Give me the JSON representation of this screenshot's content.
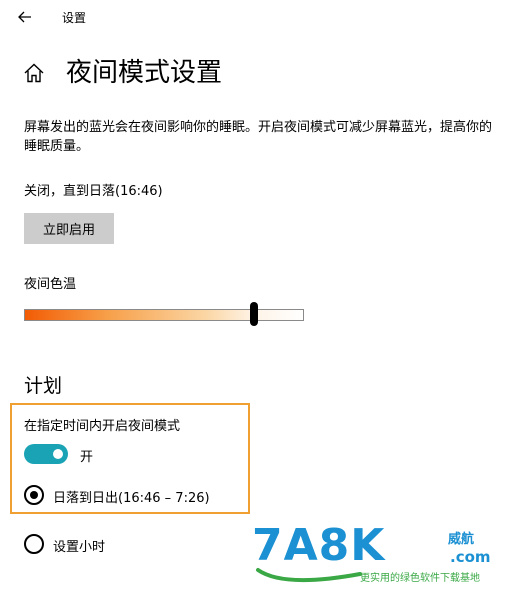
{
  "window": {
    "app_title": "设置",
    "back_icon": "arrow-left-icon"
  },
  "header": {
    "home_icon": "home-icon",
    "title": "夜间模式设置"
  },
  "intro": {
    "description": "屏幕发出的蓝光会在夜间影响你的睡眠。开启夜间模式可减少屏幕蓝光，提高你的睡眠质量。"
  },
  "status": {
    "text": "关闭，直到日落(16:46)",
    "enable_now_label": "立即启用"
  },
  "color_temperature": {
    "label": "夜间色温",
    "value_fraction": 0.82
  },
  "schedule": {
    "heading": "计划",
    "toggle_label": "在指定时间内开启夜间模式",
    "toggle_on": true,
    "toggle_state_text": "开",
    "options": [
      {
        "label": "日落到日出(16:46 – 7:26)",
        "selected": true
      },
      {
        "label": "设置小时",
        "selected": false
      }
    ]
  },
  "colors": {
    "toggle_accent": "#1aa3b5",
    "highlight_border": "#f0a030",
    "button_gray": "#cccccc"
  },
  "watermark": {
    "logo_text": "7A8K",
    "badge_text": "威航",
    "suffix_text": ".com",
    "slogan": "更实用的绿色软件下载基地"
  }
}
